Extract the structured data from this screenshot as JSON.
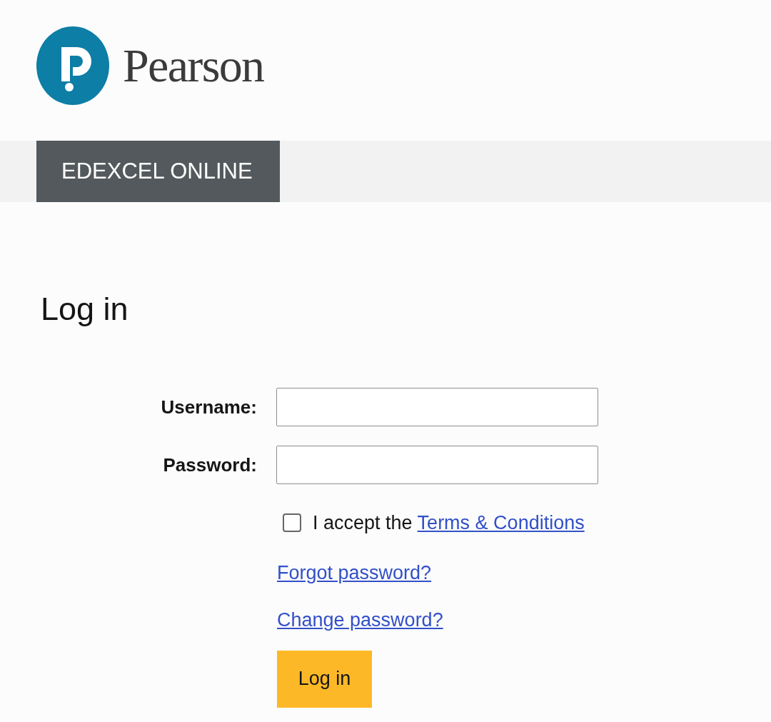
{
  "header": {
    "brand": "Pearson"
  },
  "nav": {
    "tabs": [
      {
        "label": "EDEXCEL ONLINE",
        "selected": true
      }
    ]
  },
  "heading": "Log in",
  "form": {
    "fields": [
      {
        "label": "Username:"
      },
      {
        "label": "Password:"
      }
    ],
    "terms": {
      "checked": false,
      "text": "I accept the ",
      "link": "Terms & Conditions"
    },
    "links": [
      "Forgot password?",
      "Change password?"
    ],
    "submit": "Log in"
  }
}
